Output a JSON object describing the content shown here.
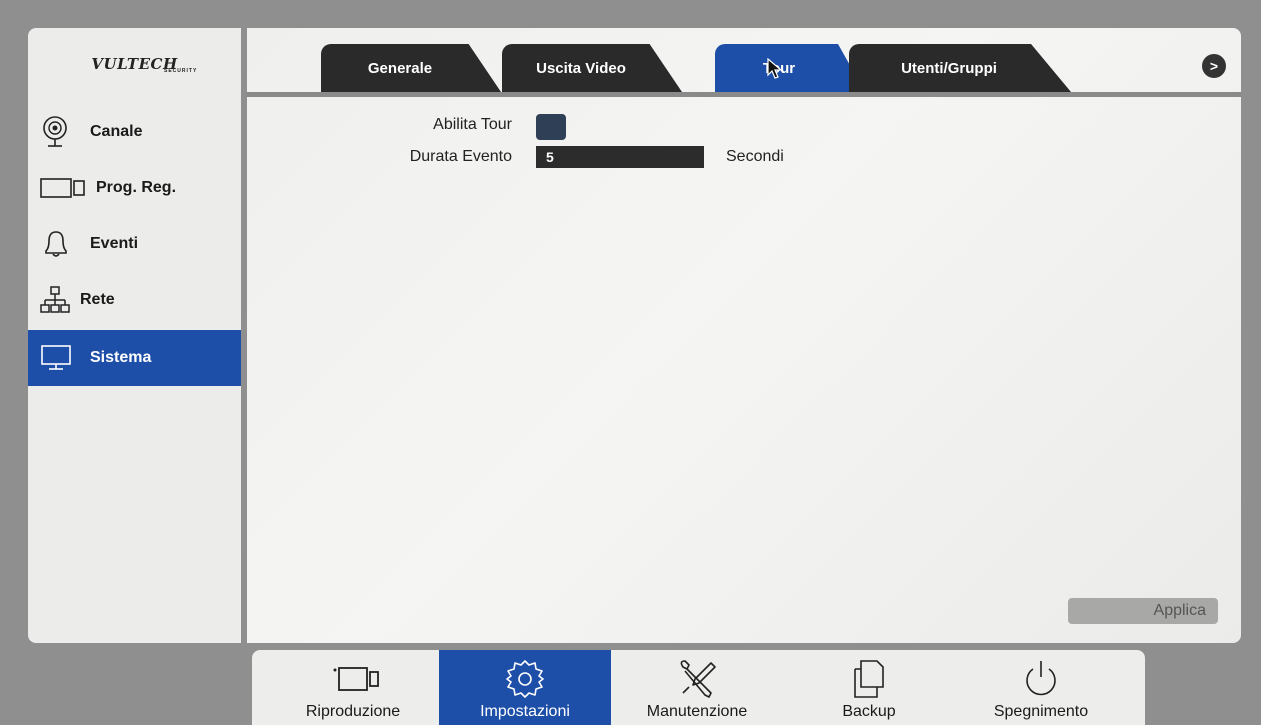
{
  "brand": {
    "logo": "VULTECH",
    "logo_sub": "SECURITY"
  },
  "sidebar": {
    "items": [
      {
        "label": "Canale",
        "icon": "camera-icon"
      },
      {
        "label": "Prog. Reg.",
        "icon": "record-schedule-icon"
      },
      {
        "label": "Eventi",
        "icon": "bell-icon"
      },
      {
        "label": "Rete",
        "icon": "network-icon"
      },
      {
        "label": "Sistema",
        "icon": "monitor-icon",
        "active": true
      }
    ]
  },
  "tabs": [
    {
      "label": "Generale"
    },
    {
      "label": "Uscita Video"
    },
    {
      "label": "Tour",
      "active": true
    },
    {
      "label": "Utenti/Gruppi"
    }
  ],
  "tab_next_label": ">",
  "form": {
    "enable_tour_label": "Abilita Tour",
    "enable_tour_checked": false,
    "duration_label": "Durata Evento",
    "duration_value": "5",
    "duration_unit": "Secondi",
    "apply_label": "Applica"
  },
  "toolbar": {
    "items": [
      {
        "label": "Riproduzione",
        "icon": "playback-camera-icon"
      },
      {
        "label": "Impostazioni",
        "icon": "gear-icon",
        "active": true
      },
      {
        "label": "Manutenzione",
        "icon": "tools-icon"
      },
      {
        "label": "Backup",
        "icon": "copy-icon"
      },
      {
        "label": "Spegnimento",
        "icon": "power-icon"
      }
    ]
  },
  "colors": {
    "accent": "#1e4fa8",
    "tab_dark": "#2a2a2a",
    "panel_bg": "#f0f0ee"
  }
}
